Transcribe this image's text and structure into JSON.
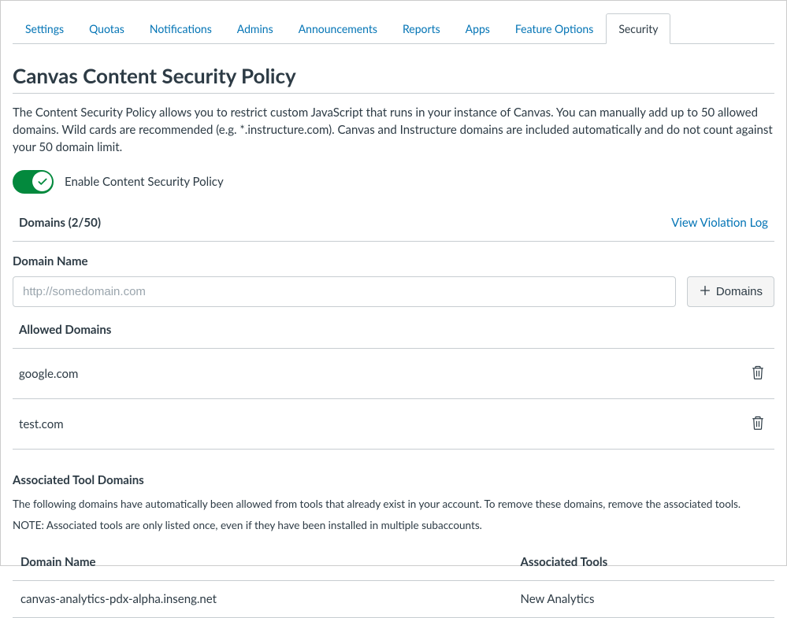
{
  "tabs": [
    {
      "label": "Settings",
      "active": false
    },
    {
      "label": "Quotas",
      "active": false
    },
    {
      "label": "Notifications",
      "active": false
    },
    {
      "label": "Admins",
      "active": false
    },
    {
      "label": "Announcements",
      "active": false
    },
    {
      "label": "Reports",
      "active": false
    },
    {
      "label": "Apps",
      "active": false
    },
    {
      "label": "Feature Options",
      "active": false
    },
    {
      "label": "Security",
      "active": true
    }
  ],
  "page": {
    "title": "Canvas Content Security Policy",
    "description": "The Content Security Policy allows you to restrict custom JavaScript that runs in your instance of Canvas. You can manually add up to 50 allowed domains. Wild cards are recommended (e.g. *.instructure.com). Canvas and Instructure domains are included automatically and do not count against your 50 domain limit."
  },
  "toggle": {
    "enabled": true,
    "label": "Enable Content Security Policy"
  },
  "domains_section": {
    "count_label": "Domains (2/50)",
    "view_log_label": "View Violation Log",
    "field_label": "Domain Name",
    "input_placeholder": "http://somedomain.com",
    "add_button_label": "Domains"
  },
  "allowed_domains": {
    "heading": "Allowed Domains",
    "items": [
      "google.com",
      "test.com"
    ]
  },
  "associated": {
    "heading": "Associated Tool Domains",
    "text1": "The following domains have automatically been allowed from tools that already exist in your account. To remove these domains, remove the associated tools.",
    "text2": "NOTE: Associated tools are only listed once, even if they have been installed in multiple subaccounts.",
    "columns": {
      "domain": "Domain Name",
      "tools": "Associated Tools"
    },
    "rows": [
      {
        "domain": "canvas-analytics-pdx-alpha.inseng.net",
        "tools": "New Analytics"
      }
    ]
  }
}
